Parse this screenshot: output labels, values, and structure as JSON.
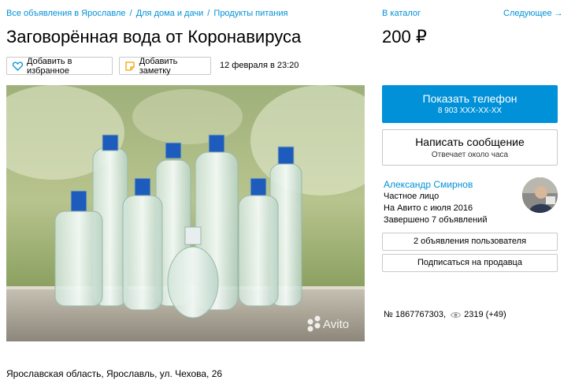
{
  "breadcrumb": {
    "items": [
      "Все объявления в Ярославле",
      "Для дома и дачи",
      "Продукты питания"
    ],
    "separator": "/"
  },
  "listing": {
    "title": "Заговорённая вода от Коронавируса",
    "favorite_label": "Добавить в избранное",
    "note_label": "Добавить заметку",
    "date": "12 февраля в 23:20",
    "address": "Ярославская область, Ярославль, ул. Чехова, 26",
    "watermark": "Avito"
  },
  "nav": {
    "catalog_label": "В каталог",
    "next_label": "Следующее →"
  },
  "price": "200 ₽",
  "contact": {
    "phone_button": "Показать телефон",
    "phone_masked": "8 903 XXX-XX-XX",
    "message_button": "Написать сообщение",
    "response_time": "Отвечает около часа"
  },
  "seller": {
    "name": "Александр Смирнов",
    "type": "Частное лицо",
    "since": "На Авито с июля 2016",
    "completed": "Завершено 7 объявлений",
    "listings_button": "2 объявления пользователя",
    "subscribe_button": "Подписаться на продавца"
  },
  "stats": {
    "ad_number": "№ 1867767303,",
    "views": "2319 (+49)"
  },
  "colors": {
    "accent": "#0091d9",
    "border": "#c9c9c9"
  },
  "icons": {
    "favorite": "heart-icon",
    "note": "note-icon",
    "views": "eye-icon"
  }
}
